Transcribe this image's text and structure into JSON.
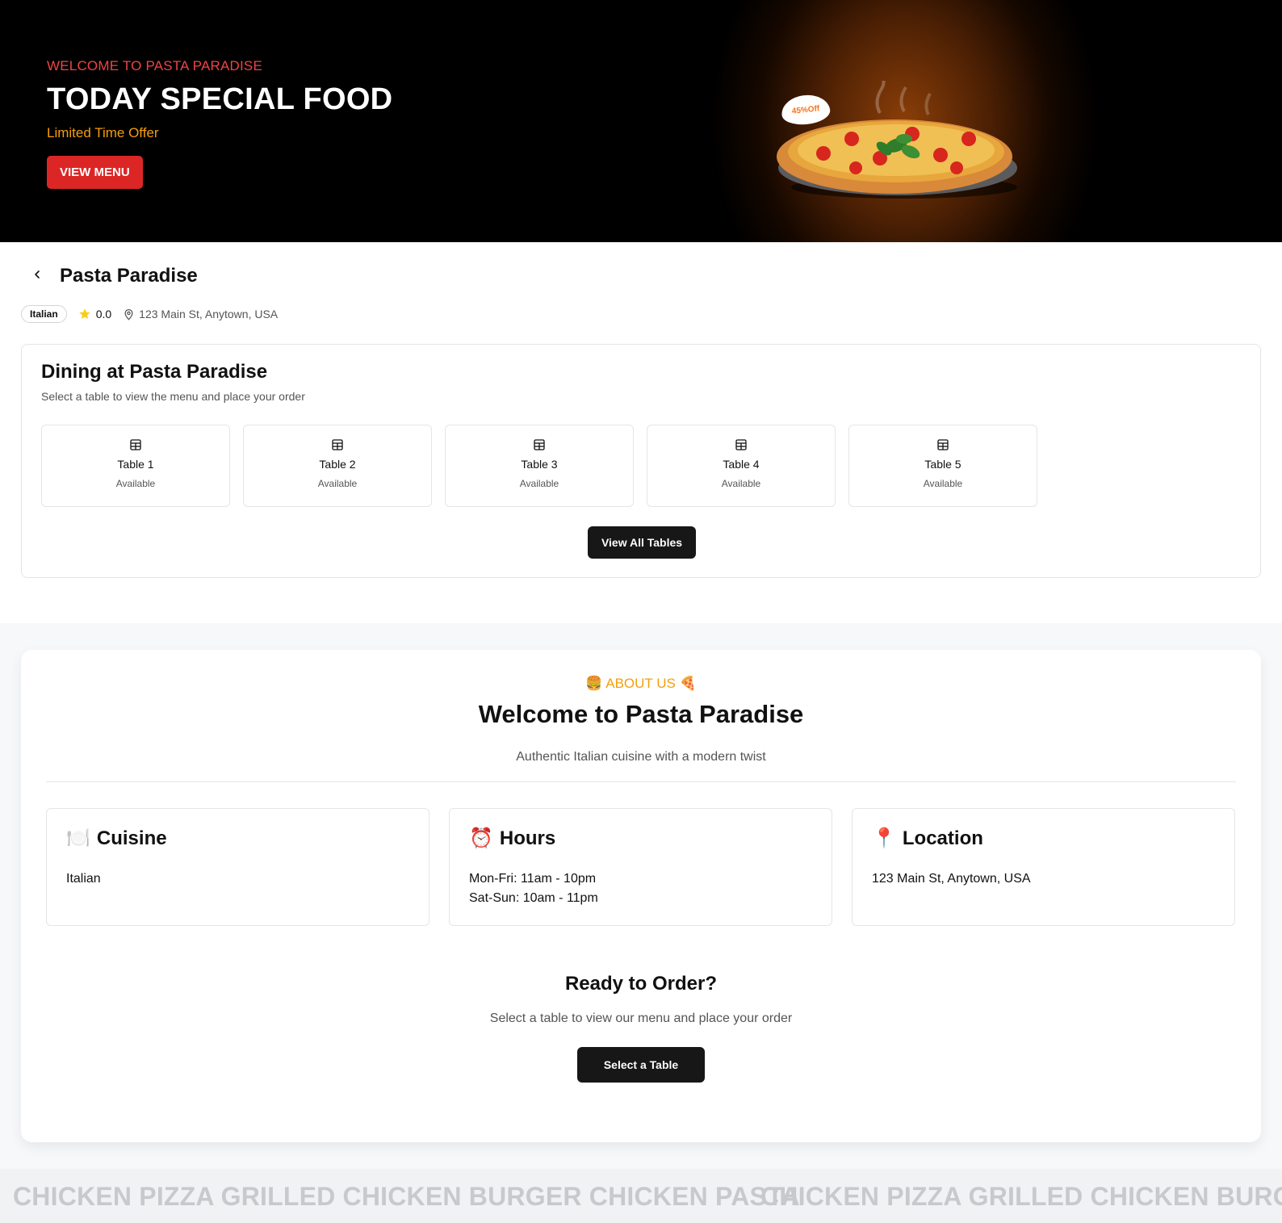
{
  "hero": {
    "kicker": "WELCOME TO PASTA PARADISE",
    "title": "TODAY SPECIAL FOOD",
    "offer": "Limited Time Offer",
    "button_label": "VIEW MENU",
    "badge": "45%Off"
  },
  "restaurant": {
    "name": "Pasta Paradise",
    "cuisine_tag": "Italian",
    "rating": "0.0",
    "address": "123 Main St, Anytown, USA"
  },
  "dining": {
    "title": "Dining at Pasta Paradise",
    "subtitle": "Select a table to view the menu and place your order",
    "tables": [
      {
        "name": "Table 1",
        "status": "Available"
      },
      {
        "name": "Table 2",
        "status": "Available"
      },
      {
        "name": "Table 3",
        "status": "Available"
      },
      {
        "name": "Table 4",
        "status": "Available"
      },
      {
        "name": "Table 5",
        "status": "Available"
      }
    ],
    "view_all_label": "View All Tables"
  },
  "about": {
    "kicker": "🍔 ABOUT US 🍕",
    "title": "Welcome to Pasta Paradise",
    "subtitle": "Authentic Italian cuisine with a modern twist",
    "cards": [
      {
        "icon": "🍽️",
        "title": "Cuisine",
        "lines": [
          "Italian"
        ]
      },
      {
        "icon": "⏰",
        "title": "Hours",
        "lines": [
          "Mon-Fri: 11am - 10pm",
          "Sat-Sun: 10am - 11pm"
        ]
      },
      {
        "icon": "📍",
        "title": "Location",
        "lines": [
          "123 Main St, Anytown, USA"
        ]
      }
    ],
    "ready_title": "Ready to Order?",
    "ready_subtitle": "Select a table to view our menu and place your order",
    "select_button_label": "Select a Table"
  },
  "marquee": {
    "text_1": "CHICKEN PIZZA GRILLED CHICKEN BURGER CHICKEN PASTA",
    "text_2": "CHICKEN PIZZA GRILLED CHICKEN BURGER"
  },
  "colors": {
    "accent_red": "#dc2626",
    "accent_orange": "#f59e0b",
    "dark_button": "#171717"
  }
}
